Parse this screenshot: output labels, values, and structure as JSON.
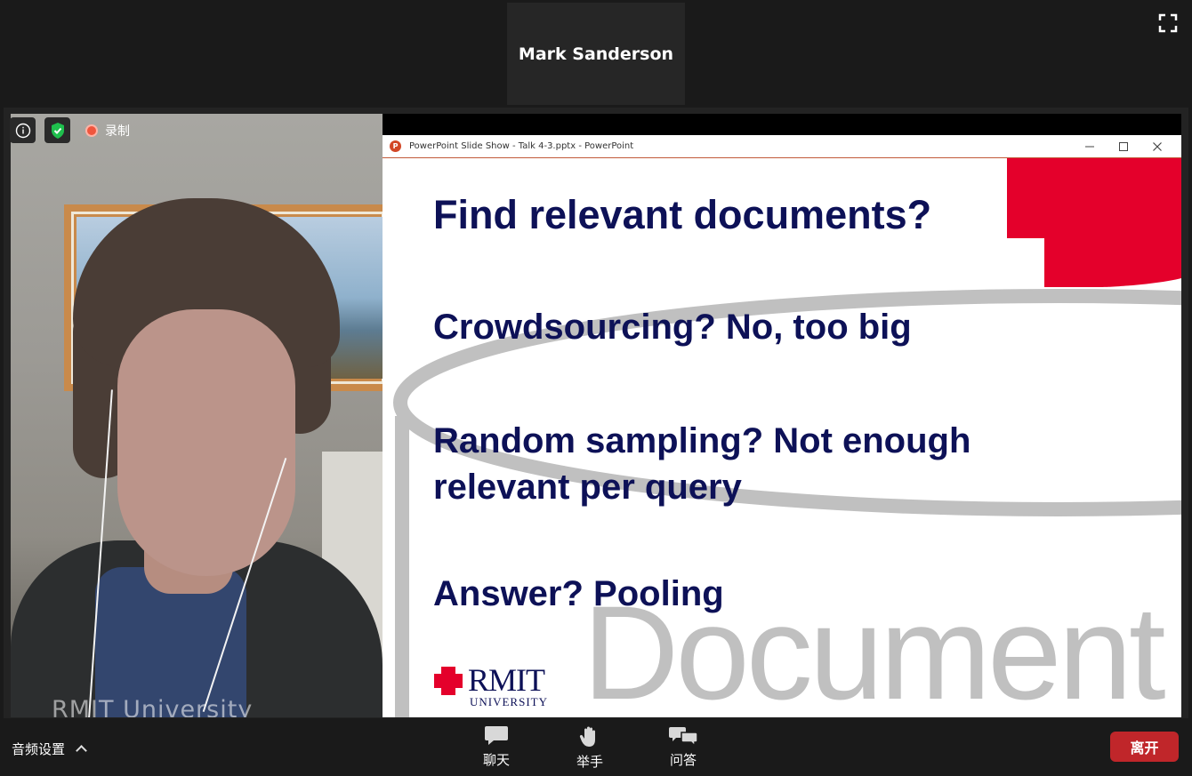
{
  "speaker": {
    "name": "Mark Sanderson"
  },
  "toolbar_top": {
    "fullscreen_icon": "fullscreen-icon"
  },
  "camera": {
    "info_icon": "info-icon",
    "security_icon": "shield-check-icon",
    "recording_label": "录制",
    "watermark": "RMIT University"
  },
  "powerpoint": {
    "window_title": "PowerPoint Slide Show  -  Talk 4-3.pptx - PowerPoint",
    "buttons": [
      "minimize",
      "maximize",
      "close"
    ]
  },
  "slide": {
    "title": "Find relevant documents?",
    "bullet1": "Crowdsourcing? No, too big",
    "bullet2_line1": "Random sampling? Not enough",
    "bullet2_line2": "relevant per query",
    "bullet3": "Answer? Pooling",
    "watermark": "Document",
    "logo_name": "RMIT",
    "logo_sub": "UNIVERSITY",
    "colors": {
      "text": "#0d1157",
      "accent": "#e4002b",
      "watermark": "#c0c0c0"
    }
  },
  "bottombar": {
    "audio_settings": "音频设置",
    "chat": "聊天",
    "raise_hand": "举手",
    "qa": "问答",
    "leave": "离开"
  }
}
